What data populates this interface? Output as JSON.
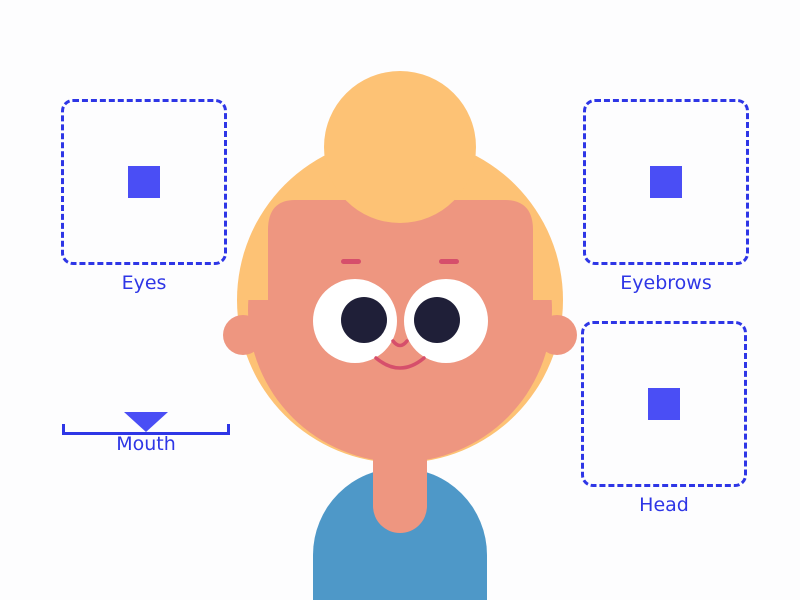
{
  "controls": {
    "eyes": {
      "label": "Eyes"
    },
    "eyebrows": {
      "label": "Eyebrows"
    },
    "head": {
      "label": "Head"
    },
    "mouth": {
      "label": "Mouth",
      "value": 0.5
    }
  },
  "colors": {
    "accent": "#2e36e6",
    "handle": "#4a4ef5",
    "hair": "#fdc275",
    "skin": "#ee9680",
    "shirt": "#4e98c8",
    "pupil": "#1f1f38",
    "feature": "#d64f6b"
  }
}
